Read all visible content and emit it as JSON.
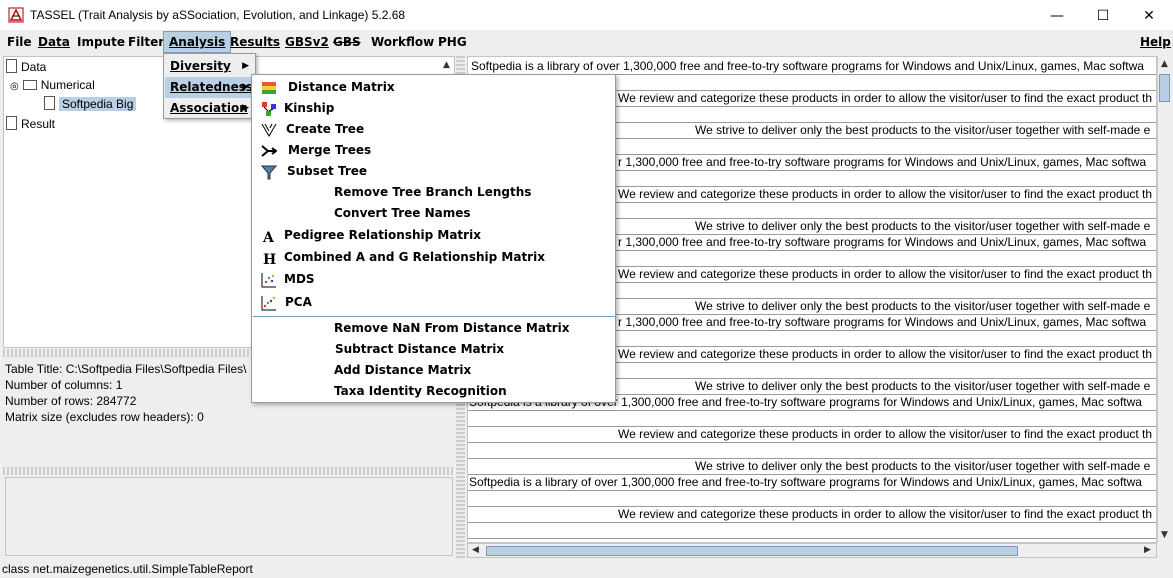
{
  "window": {
    "title": "TASSEL (Trait Analysis by aSSociation, Evolution, and Linkage) 5.2.68",
    "controls": {
      "minimize": "—",
      "maximize": "☐",
      "close": "✕"
    }
  },
  "menubar": {
    "file": "File",
    "data": "Data",
    "impute": "Impute",
    "filter": "Filter",
    "analysis": "Analysis",
    "results": "Results",
    "gbsv2": "GBSv2",
    "gbs": "GBS",
    "workflow": "Workflow",
    "phg": "PHG",
    "help": "Help"
  },
  "analysis_menu": {
    "items": [
      "Diversity",
      "Relatedness",
      "Association"
    ]
  },
  "relatedness_menu": {
    "items": [
      {
        "label": "Distance Matrix",
        "icon": "distance-matrix-icon"
      },
      {
        "label": "Kinship",
        "icon": "kinship-icon"
      },
      {
        "label": "Create Tree",
        "icon": "create-tree-icon"
      },
      {
        "label": "Merge Trees",
        "icon": "merge-trees-icon"
      },
      {
        "label": "Subset Tree",
        "icon": "subset-tree-icon"
      },
      {
        "label": "Remove Tree Branch Lengths",
        "icon": ""
      },
      {
        "label": "Convert Tree Names",
        "icon": ""
      },
      {
        "label": "Pedigree Relationship Matrix",
        "icon": "pedigree-icon"
      },
      {
        "label": "Combined A and G Relationship Matrix",
        "icon": "combined-matrix-icon"
      },
      {
        "label": "MDS",
        "icon": "mds-icon"
      },
      {
        "label": "PCA",
        "icon": "pca-icon"
      },
      {
        "label": "Remove NaN From Distance Matrix",
        "icon": ""
      },
      {
        "label": "Subtract Distance Matrix",
        "icon": ""
      },
      {
        "label": "Add Distance Matrix",
        "icon": ""
      },
      {
        "label": "Taxa Identity Recognition",
        "icon": ""
      }
    ]
  },
  "tree": {
    "data": "Data",
    "numerical": "Numerical",
    "dataset": "Softpedia Big",
    "result": "Result"
  },
  "info": {
    "table_title": "Table Title: C:\\Softpedia Files\\Softpedia Files\\",
    "columns": "Number of columns: 1",
    "rows": "Number of rows: 284772",
    "matrix_size": "Matrix size (excludes row headers): 0"
  },
  "text_lines": [
    "Softpedia is a library of over 1,300,000 free and free-to-try software programs for Windows and Unix/Linux, games, Mac softwa",
    "We review and categorize these products in order to allow the visitor/user to find the exact product th",
    "We strive to deliver only the best products to the visitor/user together with self-made e",
    "r 1,300,000 free and free-to-try software programs for Windows and Unix/Linux, games, Mac softwa",
    "Softpedia is a library of over 1,300,000 free and free-to-try software programs for Windows and Unix/Linux, games, Mac softwa"
  ],
  "statusbar": {
    "text": "class net.maizegenetics.util.SimpleTableReport"
  },
  "colors": {
    "selection": "#b8cfe5",
    "selection_border": "#7a9cc2",
    "background": "#eeeeee"
  }
}
